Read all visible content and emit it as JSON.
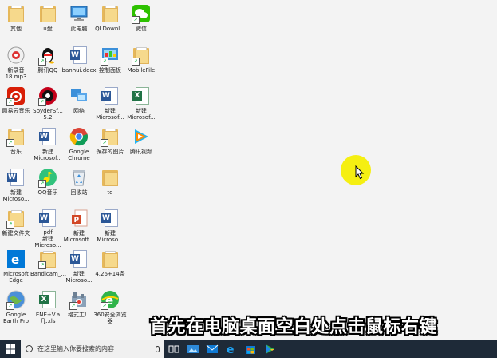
{
  "desktop_icons": [
    {
      "label": "其他"
    },
    {
      "label": "u盘"
    },
    {
      "label": "此电脑"
    },
    {
      "label": "QLDownl..."
    },
    {
      "label": "微信"
    },
    {
      "label": "新录音\n18.mp3"
    },
    {
      "label": "腾讯QQ"
    },
    {
      "label": "banhui.docx"
    },
    {
      "label": "控制面板"
    },
    {
      "label": "MobileFile"
    },
    {
      "label": "网易云音乐"
    },
    {
      "label": "SpyderSf...\n5.2"
    },
    {
      "label": "网络"
    },
    {
      "label": "新建\nMicrosof..."
    },
    {
      "label": "新建\nMicrosof..."
    },
    {
      "label": "音乐"
    },
    {
      "label": "新建\nMicrosof..."
    },
    {
      "label": "Google\nChrome"
    },
    {
      "label": "保存的图片"
    },
    {
      "label": "腾讯视频"
    },
    {
      "label": "新建\nMicroso..."
    },
    {
      "label": "QQ音乐"
    },
    {
      "label": "回收站"
    },
    {
      "label": "td"
    },
    {
      "label": "新建文件夹"
    },
    {
      "label": "pdf\n新建\nMicroso..."
    },
    {
      "label": "新建\nMicrosoft..."
    },
    {
      "label": "新建\nMicroso..."
    },
    {
      "label": "Microsoft\nEdge"
    },
    {
      "label": "Bandicam_..."
    },
    {
      "label": "新建\nMicroso..."
    },
    {
      "label": "4.26+14条"
    },
    {
      "label": "Google\nEarth Pro"
    },
    {
      "label": "ENE+V.a\n几.xls"
    },
    {
      "label": "格式工厂"
    },
    {
      "label": "360安全浏览\n器"
    }
  ],
  "caption": "首先在电脑桌面空白处点击鼠标右键",
  "taskbar": {
    "search_placeholder": "在这里输入你要搜索的内容"
  }
}
